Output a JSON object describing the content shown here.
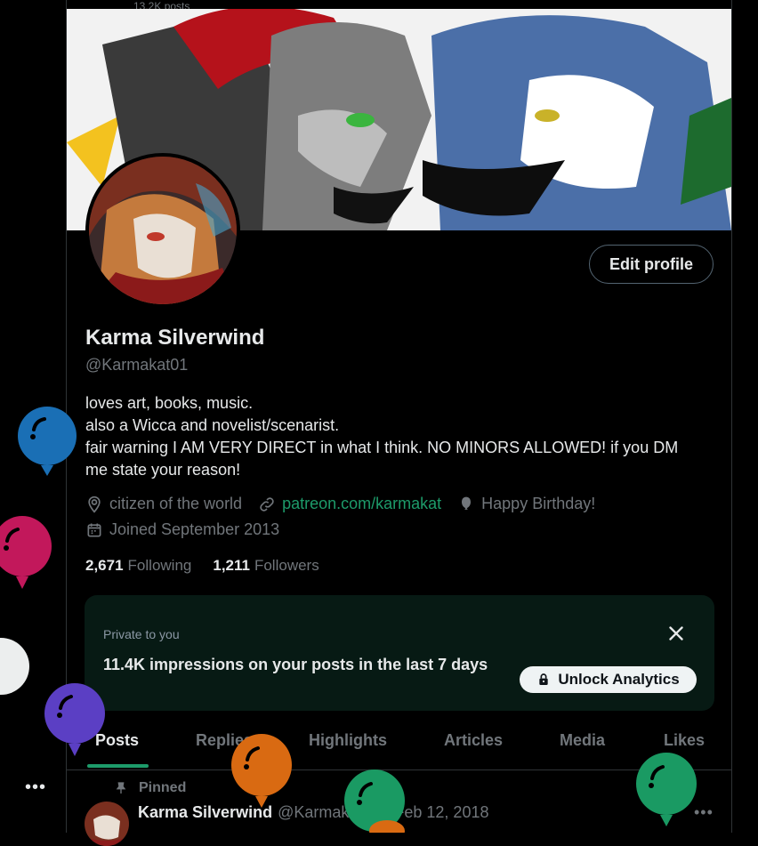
{
  "top_fade_text": "13.2K posts",
  "profile": {
    "name": "Karma Silverwind",
    "handle": "@Karmakat01",
    "edit_button": "Edit profile",
    "bio": [
      "loves art, books, music.",
      "also a Wicca and novelist/scenarist.",
      "fair warning I AM VERY DIRECT in what I think. NO MINORS ALLOWED! if you DM",
      "me state your reason!"
    ],
    "location": "citizen of the world",
    "link": "patreon.com/karmakat",
    "birthday": "Happy Birthday!",
    "joined": "Joined September 2013",
    "following_count": "2,671",
    "following_label": "Following",
    "followers_count": "1,211",
    "followers_label": "Followers"
  },
  "analytics": {
    "private_label": "Private to you",
    "impressions_text": "11.4K impressions on your posts in the last 7 days",
    "unlock_label": "Unlock Analytics"
  },
  "tabs": [
    {
      "label": "Posts",
      "active": true
    },
    {
      "label": "Replies",
      "active": false
    },
    {
      "label": "Highlights",
      "active": false
    },
    {
      "label": "Articles",
      "active": false
    },
    {
      "label": "Media",
      "active": false
    },
    {
      "label": "Likes",
      "active": false
    }
  ],
  "post": {
    "pinned_label": "Pinned",
    "author_name": "Karma Silverwind",
    "author_handle": "@Karmakat01",
    "separator": "·",
    "date": "Feb 12, 2018"
  },
  "colors": {
    "accent": "#1d9b6a",
    "balloon_blue": "#1a6fb5",
    "balloon_pink": "#c2185b",
    "balloon_purple": "#5b3fc4",
    "balloon_orange": "#d96a12",
    "balloon_green": "#1a9a63"
  },
  "icons": [
    "location-icon",
    "link-icon",
    "balloon-icon",
    "calendar-icon",
    "close-icon",
    "lock-icon",
    "pin-icon",
    "more-icon"
  ]
}
